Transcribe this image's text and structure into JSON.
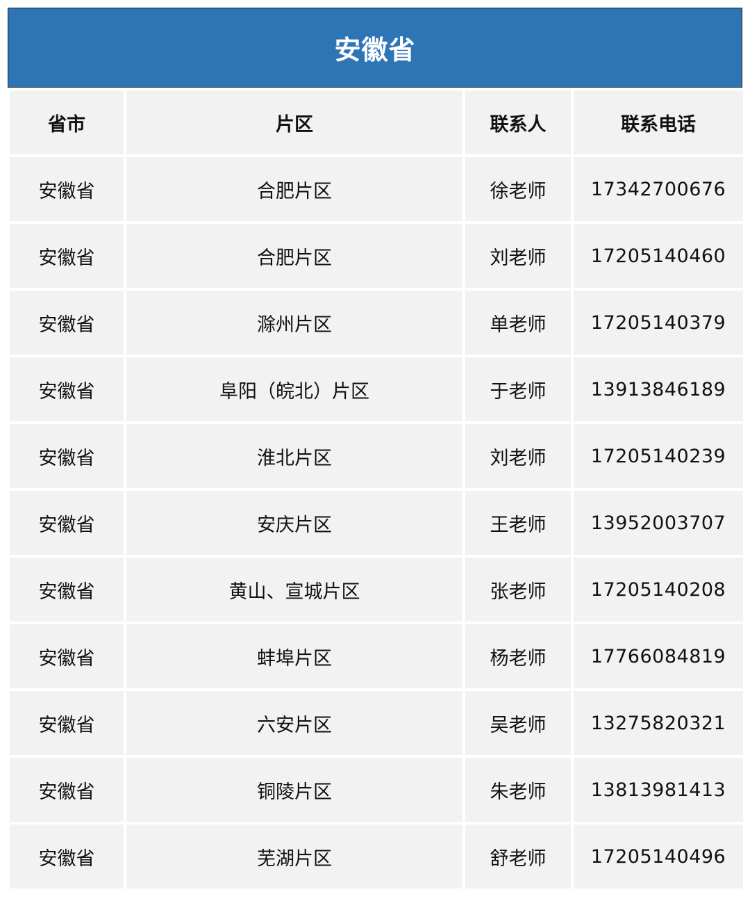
{
  "title": "安徽省",
  "headers": [
    "省市",
    "片区",
    "联系人",
    "联系电话"
  ],
  "rows": [
    [
      "安徽省",
      "合肥片区",
      "徐老师",
      "17342700676"
    ],
    [
      "安徽省",
      "合肥片区",
      "刘老师",
      "17205140460"
    ],
    [
      "安徽省",
      "滁州片区",
      "单老师",
      "17205140379"
    ],
    [
      "安徽省",
      "阜阳（皖北）片区",
      "于老师",
      "13913846189"
    ],
    [
      "安徽省",
      "淮北片区",
      "刘老师",
      "17205140239"
    ],
    [
      "安徽省",
      "安庆片区",
      "王老师",
      "13952003707"
    ],
    [
      "安徽省",
      "黄山、宣城片区",
      "张老师",
      "17205140208"
    ],
    [
      "安徽省",
      "蚌埠片区",
      "杨老师",
      "17766084819"
    ],
    [
      "安徽省",
      "六安片区",
      "吴老师",
      "13275820321"
    ],
    [
      "安徽省",
      "铜陵片区",
      "朱老师",
      "13813981413"
    ],
    [
      "安徽省",
      "芜湖片区",
      "舒老师",
      "17205140496"
    ]
  ],
  "colors": {
    "title_background": "#2e75b6",
    "cell_background": "#f2f2f2",
    "title_text": "#ffffff"
  }
}
